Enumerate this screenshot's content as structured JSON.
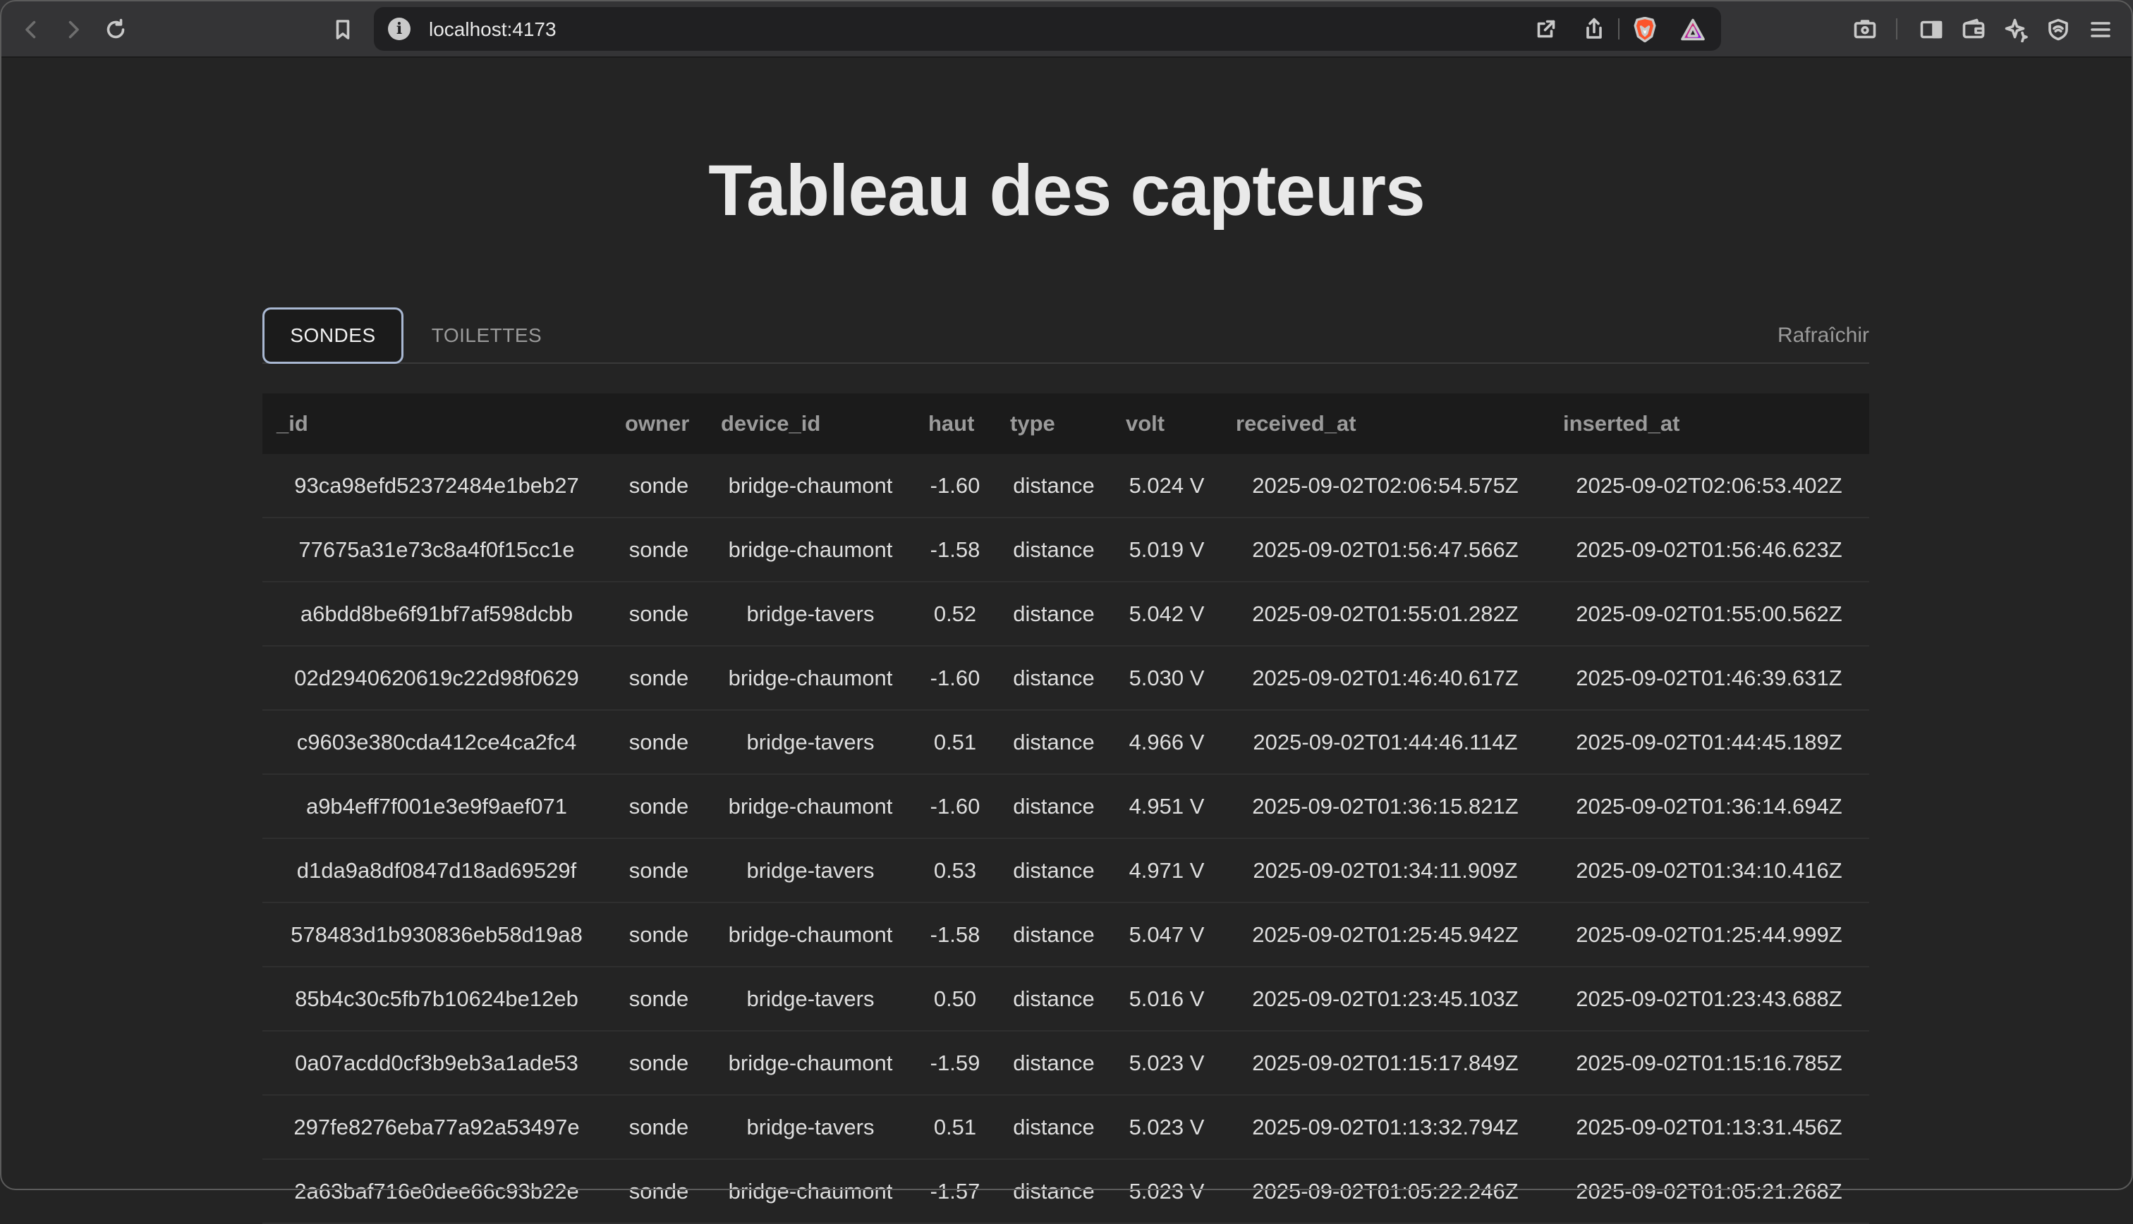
{
  "browser": {
    "url": "localhost:4173",
    "icons": [
      "back-icon",
      "forward-icon",
      "reload-icon",
      "bookmark-icon",
      "site-info-icon",
      "open-external-icon",
      "share-icon",
      "brave-shields-icon",
      "brave-rewards-icon",
      "screenshot-icon",
      "sidebar-icon",
      "wallet-icon",
      "leo-ai-icon",
      "vpn-icon",
      "menu-icon"
    ]
  },
  "page": {
    "title": "Tableau des capteurs",
    "tabs": [
      {
        "label": "SONDES",
        "active": true
      },
      {
        "label": "TOILETTES",
        "active": false
      }
    ],
    "refresh_label": "Rafraîchir"
  },
  "table": {
    "columns": [
      "_id",
      "owner",
      "device_id",
      "haut",
      "type",
      "volt",
      "received_at",
      "inserted_at"
    ],
    "rows": [
      [
        "93ca98efd52372484e1beb27",
        "sonde",
        "bridge-chaumont",
        "-1.60",
        "distance",
        "5.024 V",
        "2025-09-02T02:06:54.575Z",
        "2025-09-02T02:06:53.402Z"
      ],
      [
        "77675a31e73c8a4f0f15cc1e",
        "sonde",
        "bridge-chaumont",
        "-1.58",
        "distance",
        "5.019 V",
        "2025-09-02T01:56:47.566Z",
        "2025-09-02T01:56:46.623Z"
      ],
      [
        "a6bdd8be6f91bf7af598dcbb",
        "sonde",
        "bridge-tavers",
        "0.52",
        "distance",
        "5.042 V",
        "2025-09-02T01:55:01.282Z",
        "2025-09-02T01:55:00.562Z"
      ],
      [
        "02d2940620619c22d98f0629",
        "sonde",
        "bridge-chaumont",
        "-1.60",
        "distance",
        "5.030 V",
        "2025-09-02T01:46:40.617Z",
        "2025-09-02T01:46:39.631Z"
      ],
      [
        "c9603e380cda412ce4ca2fc4",
        "sonde",
        "bridge-tavers",
        "0.51",
        "distance",
        "4.966 V",
        "2025-09-02T01:44:46.114Z",
        "2025-09-02T01:44:45.189Z"
      ],
      [
        "a9b4eff7f001e3e9f9aef071",
        "sonde",
        "bridge-chaumont",
        "-1.60",
        "distance",
        "4.951 V",
        "2025-09-02T01:36:15.821Z",
        "2025-09-02T01:36:14.694Z"
      ],
      [
        "d1da9a8df0847d18ad69529f",
        "sonde",
        "bridge-tavers",
        "0.53",
        "distance",
        "4.971 V",
        "2025-09-02T01:34:11.909Z",
        "2025-09-02T01:34:10.416Z"
      ],
      [
        "578483d1b930836eb58d19a8",
        "sonde",
        "bridge-chaumont",
        "-1.58",
        "distance",
        "5.047 V",
        "2025-09-02T01:25:45.942Z",
        "2025-09-02T01:25:44.999Z"
      ],
      [
        "85b4c30c5fb7b10624be12eb",
        "sonde",
        "bridge-tavers",
        "0.50",
        "distance",
        "5.016 V",
        "2025-09-02T01:23:45.103Z",
        "2025-09-02T01:23:43.688Z"
      ],
      [
        "0a07acdd0cf3b9eb3a1ade53",
        "sonde",
        "bridge-chaumont",
        "-1.59",
        "distance",
        "5.023 V",
        "2025-09-02T01:15:17.849Z",
        "2025-09-02T01:15:16.785Z"
      ],
      [
        "297fe8276eba77a92a53497e",
        "sonde",
        "bridge-tavers",
        "0.51",
        "distance",
        "5.023 V",
        "2025-09-02T01:13:32.794Z",
        "2025-09-02T01:13:31.456Z"
      ],
      [
        "2a63baf716e0dee66c93b22e",
        "sonde",
        "bridge-chaumont",
        "-1.57",
        "distance",
        "5.023 V",
        "2025-09-02T01:05:22.246Z",
        "2025-09-02T01:05:21.268Z"
      ]
    ]
  },
  "colors": {
    "background": "#242424",
    "chrome": "#343436",
    "active_tab_border": "#a9b8d2",
    "header_row": "#1b1b1b"
  }
}
